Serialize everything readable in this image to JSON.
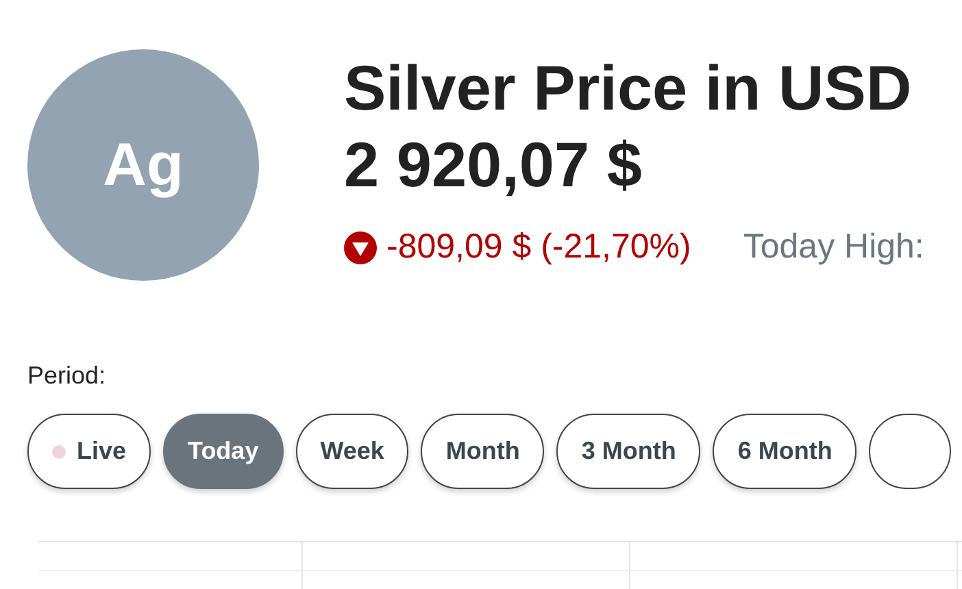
{
  "avatar": {
    "symbol": "Ag"
  },
  "title": "Silver Price in USD",
  "price": "2 920,07 $",
  "change": {
    "kind": "down",
    "text": "-809,09 $ (-21,70%)"
  },
  "today_high": {
    "label": "Today High:"
  },
  "period": {
    "label": "Period:",
    "options": [
      {
        "label": "Live",
        "kind": "live",
        "selected": false
      },
      {
        "label": "Today",
        "kind": "period",
        "selected": true
      },
      {
        "label": "Week",
        "kind": "period",
        "selected": false
      },
      {
        "label": "Month",
        "kind": "period",
        "selected": false
      },
      {
        "label": "3 Month",
        "kind": "period",
        "selected": false
      },
      {
        "label": "6 Month",
        "kind": "period",
        "selected": false
      }
    ]
  }
}
